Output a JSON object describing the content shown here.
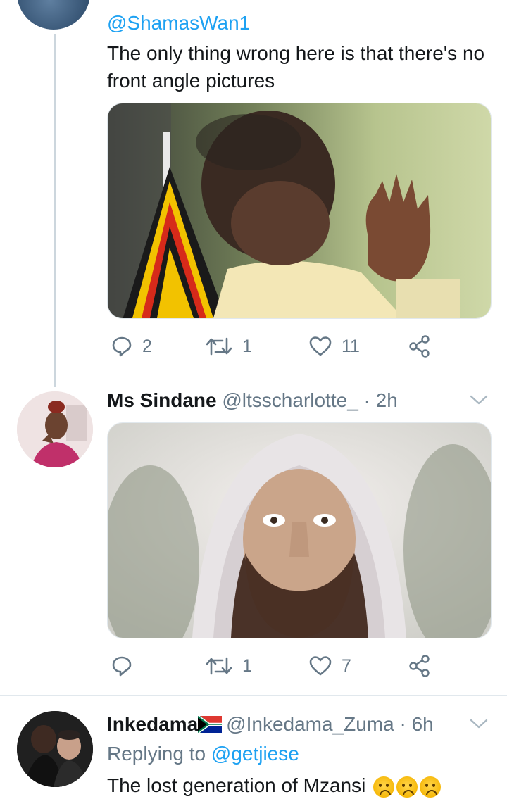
{
  "thread": {
    "reply1": {
      "handle": "@ShamasWan1",
      "text": "The only thing wrong here is that there's no front angle pictures",
      "stats": {
        "replies": "2",
        "retweets": "1",
        "likes": "11"
      }
    },
    "tweet2": {
      "name": "Ms Sindane",
      "handle": "@ltsscharlotte_",
      "time": "· 2h",
      "stats": {
        "replies": "",
        "retweets": "1",
        "likes": "7"
      }
    },
    "tweet3": {
      "name": "Inkedama",
      "handle": "@Inkedama_Zuma",
      "time": "· 6h",
      "replying_prefix": "Replying to",
      "replying_handle": "@getjiese",
      "text": "The lost generation of Mzansi"
    }
  },
  "icons": [
    "reply-icon",
    "retweet-icon",
    "like-icon",
    "share-icon",
    "chevron-down-icon",
    "south-africa-flag-icon",
    "worried-face-icon"
  ],
  "colors": {
    "link": "#1da1f2",
    "muted": "#657786",
    "text": "#14171a",
    "divider": "#e1e8ed"
  }
}
